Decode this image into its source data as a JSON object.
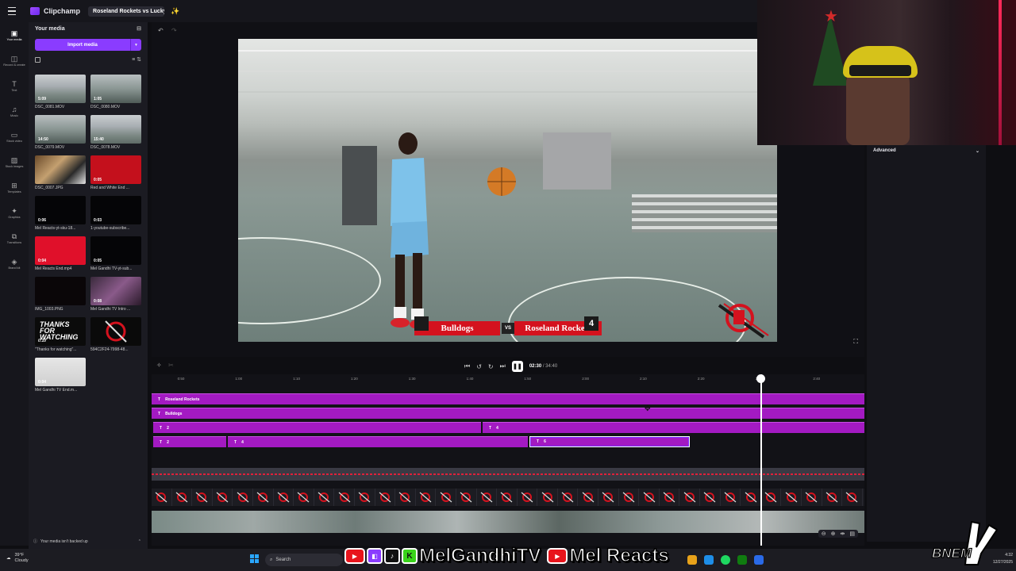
{
  "app": {
    "name": "Clipchamp",
    "project_title": "Roseland Rockets vs Lucky L"
  },
  "rail": [
    {
      "icon": "▣",
      "label": "Your media",
      "active": true
    },
    {
      "icon": "◫",
      "label": "Record & create"
    },
    {
      "icon": "T",
      "label": "Text"
    },
    {
      "icon": "♫",
      "label": "Music"
    },
    {
      "icon": "▭",
      "label": "Stock video"
    },
    {
      "icon": "▨",
      "label": "Stock images"
    },
    {
      "icon": "⊞",
      "label": "Templates"
    },
    {
      "icon": "✦",
      "label": "Graphics"
    },
    {
      "icon": "⧉",
      "label": "Transitions"
    },
    {
      "icon": "◈",
      "label": "Brand kit"
    }
  ],
  "media": {
    "title": "Your media",
    "import_label": "Import media",
    "backup_notice": "Your media isn't backed up",
    "items": [
      {
        "name": "DSC_0081.MOV",
        "duration": "5:09",
        "thumb": "th-gym"
      },
      {
        "name": "DSC_0080.MOV",
        "duration": "1:05",
        "thumb": "th-gym2"
      },
      {
        "name": "DSC_0079.MOV",
        "duration": "14:50",
        "thumb": "th-gym2"
      },
      {
        "name": "DSC_0078.MOV",
        "duration": "15:40",
        "thumb": "th-gym"
      },
      {
        "name": "DSC_0007.JPG",
        "duration": "",
        "thumb": "th-dsc7"
      },
      {
        "name": "Red and White End ...",
        "duration": "0:05",
        "thumb": "th-red"
      },
      {
        "name": "Mel Reacts-yt-sku-18...",
        "duration": "0:06",
        "thumb": "th-black"
      },
      {
        "name": "1-youtube-subscribe...",
        "duration": "0:03",
        "thumb": "th-black"
      },
      {
        "name": "Mel Reacts End.mp4",
        "duration": "0:04",
        "thumb": "th-redmp4"
      },
      {
        "name": "Mel Gandhi TV-yt-sub...",
        "duration": "0:05",
        "thumb": "th-black"
      },
      {
        "name": "IMG_1003.PNG",
        "duration": "",
        "thumb": "th-img1003"
      },
      {
        "name": "Mel Gandhi TV Intro ...",
        "duration": "0:08",
        "thumb": "th-intro"
      },
      {
        "name": "\"Thanks for watching\"...",
        "duration": "0:10",
        "thumb": "th-thanks",
        "overlay": "THANKS FOR WATCHING"
      },
      {
        "name": "594C2F24-7998-48...",
        "duration": "",
        "thumb": "th-logo"
      },
      {
        "name": "Mel Gandhi TV End.m...",
        "duration": "0:04",
        "thumb": "th-grey"
      }
    ]
  },
  "scoreboard": {
    "team_left": "Bulldogs",
    "vs": "VS",
    "team_right": "Roseland Rockets",
    "score_right": "4"
  },
  "transport": {
    "current": "02:30",
    "total": "/ 34:40"
  },
  "timeline": {
    "ticks": [
      "0:50",
      "1:00",
      "1:10",
      "1:20",
      "1:30",
      "1:40",
      "1:50",
      "2:00",
      "2:10",
      "2:20",
      "2:30",
      "2:40"
    ],
    "text_tracks": [
      [
        {
          "label": "Roseland Rockets",
          "start": 0,
          "end": 898
        }
      ],
      [
        {
          "label": "Bulldogs",
          "start": 0,
          "end": 898
        }
      ],
      [
        {
          "label": "2",
          "start": 2,
          "end": 415
        },
        {
          "label": "4",
          "start": 417,
          "end": 898
        }
      ],
      [
        {
          "label": "2",
          "start": 2,
          "end": 94
        },
        {
          "label": "4",
          "start": 96,
          "end": 474
        },
        {
          "label": "6",
          "start": 476,
          "end": 678,
          "selected": true
        }
      ]
    ]
  },
  "properties": {
    "advanced_label": "Advanced"
  },
  "taskbar": {
    "temp": "39°F",
    "weather": "Cloudy",
    "search": "Search",
    "time": "4:32",
    "date": "12/27/2025"
  },
  "overlay": {
    "channel1": "MelGandhiTV",
    "channel2": "Mel Reacts",
    "watermark": "BNEM"
  },
  "colors": {
    "accent": "#8a3cff",
    "clip": "#a31ac2",
    "score_red": "#d4121e"
  }
}
